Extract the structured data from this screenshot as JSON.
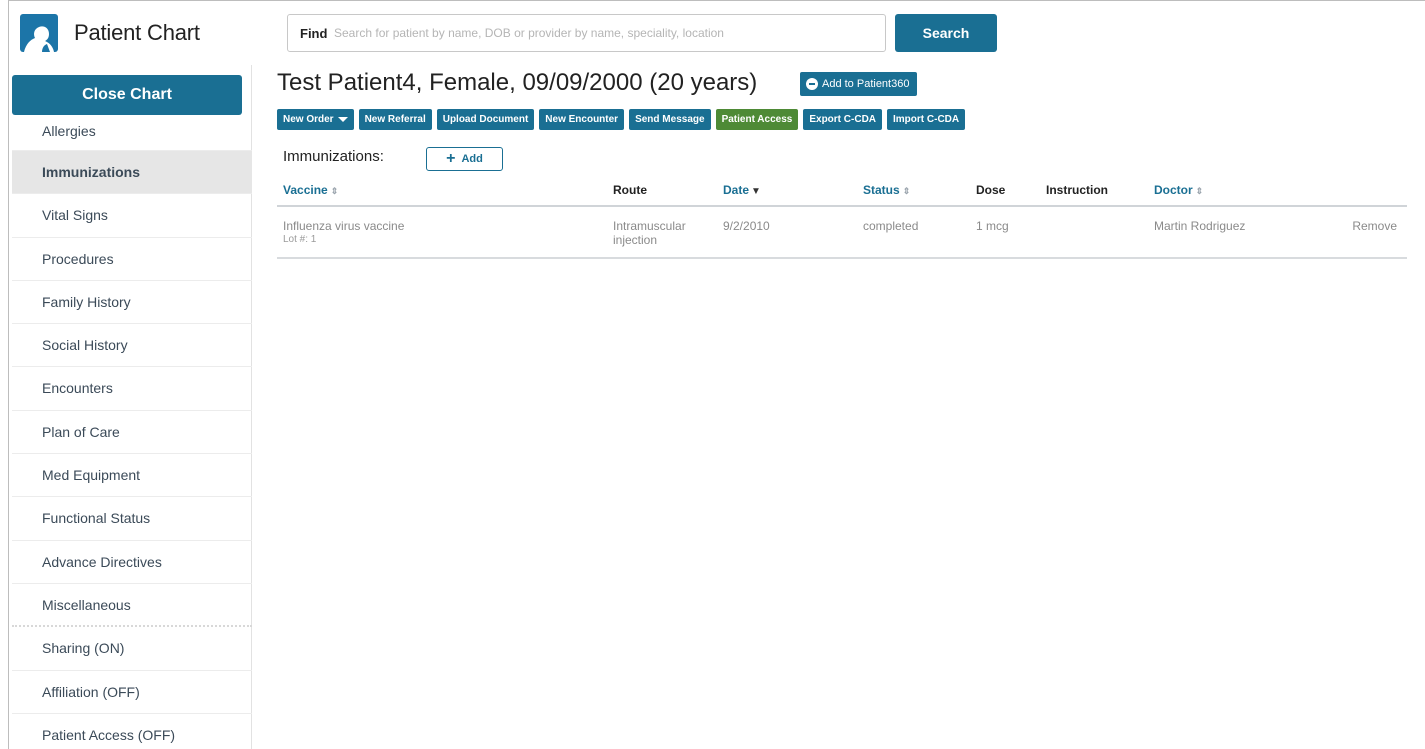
{
  "app": {
    "title": "Patient Chart",
    "logo_icon": "patient-chart-logo-icon"
  },
  "search": {
    "label": "Find",
    "placeholder": "Search for patient by name, DOB or provider by name, speciality, location",
    "button": "Search"
  },
  "sidebar": {
    "close_chart": "Close Chart",
    "items": [
      {
        "label": "Allergies"
      },
      {
        "label": "Immunizations",
        "active": true
      },
      {
        "label": "Vital Signs"
      },
      {
        "label": "Procedures"
      },
      {
        "label": "Family History"
      },
      {
        "label": "Social History"
      },
      {
        "label": "Encounters"
      },
      {
        "label": "Plan of Care"
      },
      {
        "label": "Med Equipment"
      },
      {
        "label": "Functional Status"
      },
      {
        "label": "Advance Directives"
      },
      {
        "label": "Miscellaneous"
      },
      {
        "label": "Sharing (ON)"
      },
      {
        "label": "Affiliation (OFF)"
      },
      {
        "label": "Patient Access (OFF)"
      }
    ]
  },
  "patient": {
    "title": "Test Patient4, Female, 09/09/2000 (20 years)",
    "add_to_360": "Add to Patient360"
  },
  "actions": {
    "new_order": "New Order",
    "new_referral": "New Referral",
    "upload_document": "Upload Document",
    "new_encounter": "New Encounter",
    "send_message": "Send Message",
    "patient_access": "Patient Access",
    "export_ccda": "Export C-CDA",
    "import_ccda": "Import C-CDA"
  },
  "immunizations": {
    "section_title": "Immunizations:",
    "add_label": "Add",
    "columns": {
      "vaccine": "Vaccine",
      "route": "Route",
      "date": "Date",
      "status": "Status",
      "dose": "Dose",
      "instruction": "Instruction",
      "doctor": "Doctor"
    },
    "rows": [
      {
        "vaccine": "Influenza virus vaccine",
        "lot": "Lot #: 1",
        "route_1": "Intramuscular",
        "route_2": "injection",
        "date": "9/2/2010",
        "status": "completed",
        "dose": "1 mcg",
        "instruction": "",
        "doctor": "Martin Rodriguez",
        "action": "Remove"
      }
    ]
  },
  "colors": {
    "primary": "#1a6f93",
    "success": "#4e8a36",
    "active_row": "#e6e6e6"
  }
}
